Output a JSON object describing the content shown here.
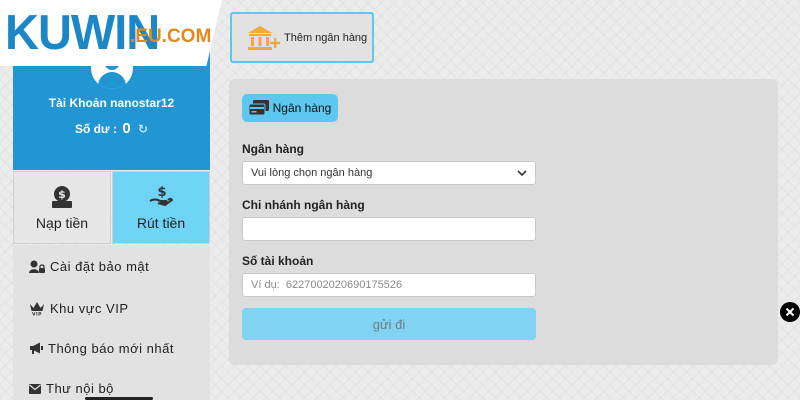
{
  "logo": {
    "main": "KUWIN",
    "suffix": ".EU.COM"
  },
  "profile": {
    "account_label": "Tài Khoản",
    "username": "nanostar12",
    "balance_label": "Số dư :",
    "balance_value": "0"
  },
  "actions": {
    "deposit": "Nạp tiền",
    "withdraw": "Rút tiền"
  },
  "menu": {
    "items": [
      {
        "label": "Cài đặt bảo mật",
        "icon": "user-lock-icon"
      },
      {
        "label": "Khu vực VIP",
        "icon": "vip-crown-icon"
      },
      {
        "label": "Thông báo mới nhất",
        "icon": "megaphone-icon"
      },
      {
        "label": "Thư nội bộ",
        "icon": "envelope-icon"
      }
    ]
  },
  "add_bank": {
    "label": "Thêm ngân hàng"
  },
  "form": {
    "tab_label": "Ngân hàng",
    "bank_label": "Ngân hàng",
    "bank_select_value": "Vui lòng chọn ngân hàng",
    "branch_label": "Chi nhánh ngân hàng",
    "branch_value": "",
    "account_no_label": "Số tài khoản",
    "account_no_placeholder": "Ví dụ:  6227002020690175526",
    "submit_label": "gửi đi"
  },
  "colors": {
    "brand_blue": "#2196d3",
    "accent_cyan": "#5cc7ef",
    "logo_orange": "#e08a1e",
    "icon_gold": "#f2a93b"
  }
}
